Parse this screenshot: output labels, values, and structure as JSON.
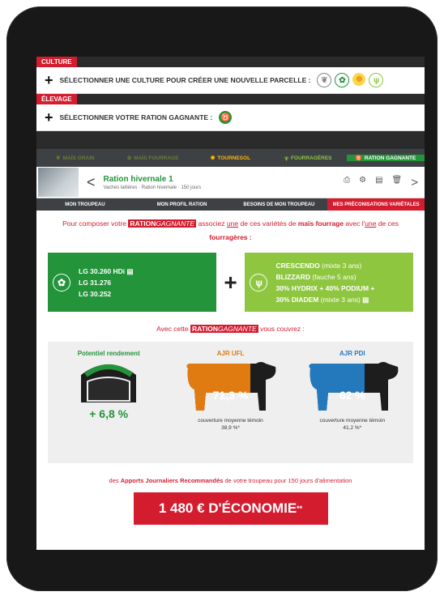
{
  "culture": {
    "tag": "CULTURE",
    "prompt": "SÉLECTIONNER UNE CULTURE POUR CRÉER UNE NOUVELLE PARCELLE :"
  },
  "elevage": {
    "tag": "ÉLEVAGE",
    "prompt": "SÉLECTIONNER VOTRE RATION GAGNANTE :"
  },
  "tabs": [
    {
      "label": "MAÏS GRAIN",
      "icon": "leaf-icon"
    },
    {
      "label": "MAÏS FOURRAGE",
      "icon": "plant-icon"
    },
    {
      "label": "TOURNESOL",
      "icon": "sunflower-icon"
    },
    {
      "label": "FOURRAGÈRES",
      "icon": "grass-icon"
    },
    {
      "label": "RATION GAGNANTE",
      "icon": "cow-icon"
    }
  ],
  "ration": {
    "title": "Ration hivernale 1",
    "subtitle": "Vaches laitières · Ration hivernale · 150 jours"
  },
  "subtabs": [
    "MON TROUPEAU",
    "MON PROFIL RATION",
    "BESOINS DE MON TROUPEAU",
    "MES PRÉCONISATIONS VARIÉTALES"
  ],
  "intro": {
    "pre": "Pour composer votre",
    "badge_bold": "RATION",
    "badge_italic": "GAGNANTE",
    "mid": "associez",
    "une": "une",
    "mid2": "de ces variétés de",
    "mais": "maïs fourrage",
    "mid3": "avec l'",
    "une2": "une",
    "mid4": "de ces",
    "fourrageres": "fourragères :"
  },
  "left_card": [
    "LG 30.260 HDi",
    "LG 31.276",
    "LG 30.252"
  ],
  "right_card": [
    {
      "bold": "CRESCENDO",
      "normal": " (mixte 3 ans)"
    },
    {
      "bold": "BLIZZARD",
      "normal": " (fauche 5 ans)"
    },
    {
      "bold": "30% HYDRIX + 40% PODIUM +",
      "normal": ""
    },
    {
      "bold": "30% DIADEM",
      "normal": " (mixte 3 ans)"
    }
  ],
  "cover": {
    "pre": "Avec cette",
    "badge_bold": "RATION",
    "badge_italic": "GAGNANTE",
    "post": "vous couvrez :"
  },
  "stats": {
    "rendement_title": "Potentiel rendement",
    "rendement_value": "+ 6,8 %",
    "ufl_title": "AJR UFL",
    "ufl_value": "71,3 %",
    "ufl_fill": 0.713,
    "ufl_caption": "couverture moyenne témoin",
    "ufl_caption_value": "38,9 %*",
    "pdi_title": "AJR PDI",
    "pdi_value": "62 %",
    "pdi_fill": 0.62,
    "pdi_caption": "couverture moyenne témoin",
    "pdi_caption_value": "41,2 %*"
  },
  "apports": {
    "pre": "des",
    "bold": "Apports Journaliers Recommandés",
    "post": "de votre troupeau pour 150 jours d'alimentation"
  },
  "economy": {
    "label": "1 480 € D'ÉCONOMIE",
    "stars": "**"
  },
  "colors": {
    "red": "#d41c2f",
    "green": "#23943a",
    "light_green": "#8ec63f",
    "orange": "#e07b12",
    "blue": "#2479bd",
    "dark": "#2b2b2b"
  }
}
